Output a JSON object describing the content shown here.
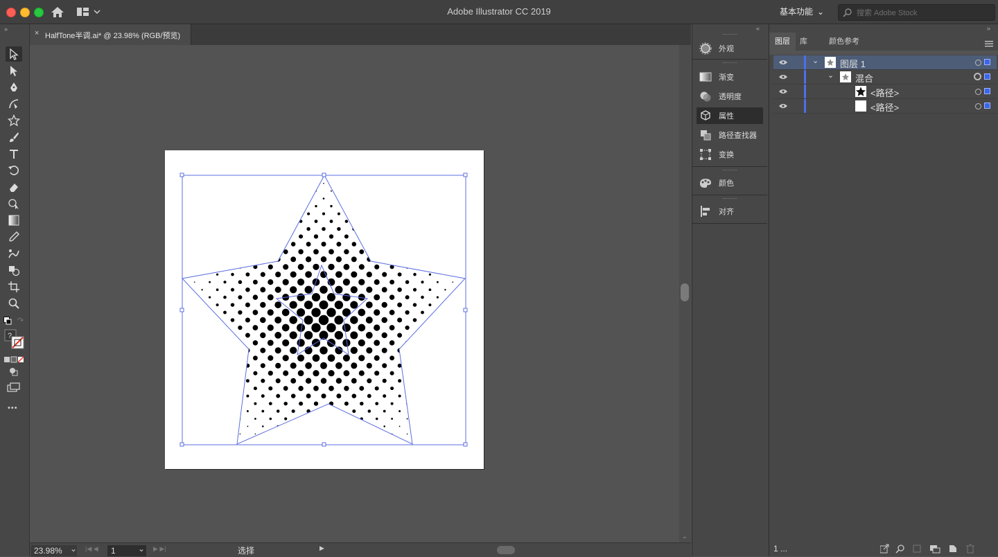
{
  "window": {
    "title": "Adobe Illustrator CC 2019"
  },
  "header": {
    "workspace_label": "基本功能",
    "search_placeholder": "搜索 Adobe Stock"
  },
  "document": {
    "tab_title": "HalfTone半调.ai* @ 23.98% (RGB/预览)"
  },
  "toolbar": {
    "tools": [
      "selection-tool",
      "direct-selection-tool",
      "pen-tool",
      "curvature-tool",
      "star-tool",
      "paintbrush-tool",
      "type-tool",
      "rotate-tool",
      "eraser-tool",
      "shape-builder-tool",
      "gradient-tool",
      "eyedropper-tool",
      "blend-tool",
      "live-paint-tool",
      "artboard-tool",
      "zoom-tool"
    ],
    "more_label": "•••"
  },
  "status": {
    "zoom": "23.98%",
    "artboard_number": "1",
    "mode": "选择"
  },
  "properties_panel": {
    "items": [
      {
        "label": "外观",
        "icon": "appearance-icon"
      },
      {
        "label": "渐变",
        "icon": "gradient-icon"
      },
      {
        "label": "透明度",
        "icon": "transparency-icon"
      },
      {
        "label": "属性",
        "icon": "properties-icon"
      },
      {
        "label": "路径查找器",
        "icon": "pathfinder-icon"
      },
      {
        "label": "变换",
        "icon": "transform-icon"
      },
      {
        "label": "颜色",
        "icon": "color-icon"
      },
      {
        "label": "对齐",
        "icon": "align-icon"
      }
    ]
  },
  "layers_panel": {
    "tabs": [
      "图层",
      "库",
      "颜色参考"
    ],
    "rows": [
      {
        "name": "图层 1"
      },
      {
        "name": "混合"
      },
      {
        "name": "<路径>"
      },
      {
        "name": "<路径>"
      }
    ],
    "footer_count": "1 ..."
  },
  "colors": {
    "selection": "#4e6fe6",
    "layer_highlight": "#4d5d78"
  }
}
